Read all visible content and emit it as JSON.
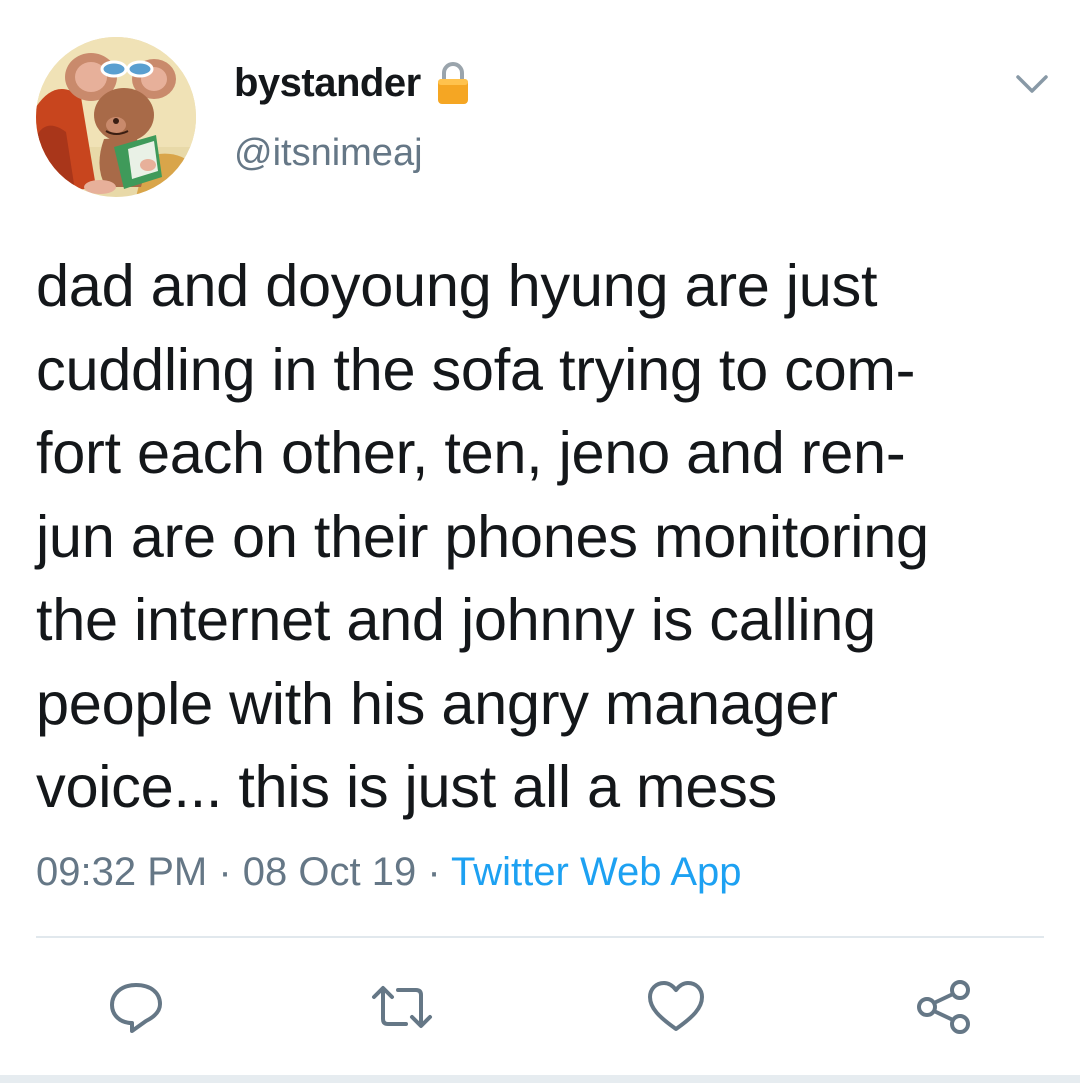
{
  "user": {
    "display_name": "bystander",
    "handle": "@itsnimeaj",
    "protected_icon": "lock-icon",
    "avatar": "avatar-cartoon-mouse-reading"
  },
  "tweet": {
    "text": "dad and doyoung hyung are just\ncuddling in the sofa trying to com-\nfort each other, ten, jeno and ren-\njun are on their phones monitoring\nthe internet and johnny is calling\npeople with his angry manager\nvoice... this is just all a mess",
    "time": "09:32 PM",
    "separator": " · ",
    "date": "08 Oct 19",
    "source": "Twitter Web App"
  },
  "actions": {
    "reply_icon": "reply-icon",
    "retweet_icon": "retweet-icon",
    "like_icon": "heart-icon",
    "share_icon": "share-icon"
  },
  "colors": {
    "text": "#14171a",
    "secondary": "#657786",
    "link": "#1da1f2",
    "divider": "#e1e8ed",
    "lock": "#f5a623"
  }
}
